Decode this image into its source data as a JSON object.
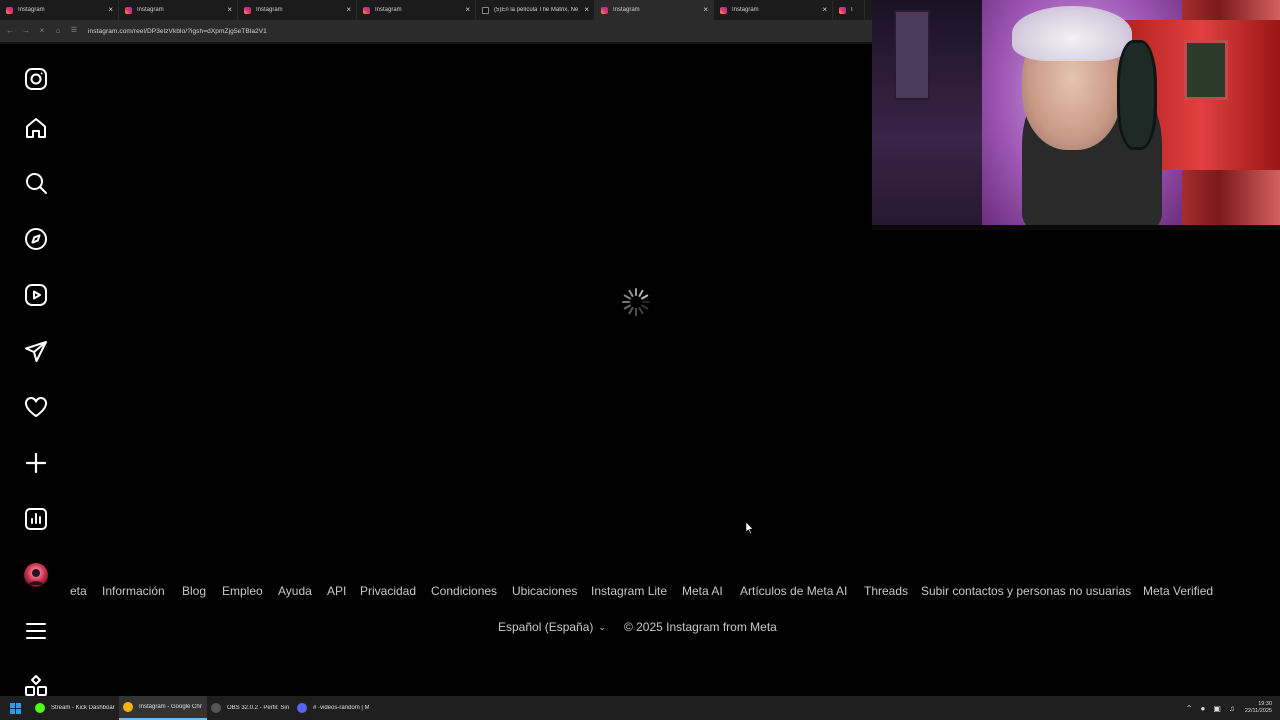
{
  "browser": {
    "tabs": [
      {
        "title": "Instagram",
        "icon": "instagram-favicon",
        "active": false
      },
      {
        "title": "Instagram",
        "icon": "instagram-favicon",
        "active": false
      },
      {
        "title": "Instagram",
        "icon": "instagram-favicon",
        "active": false
      },
      {
        "title": "Instagram",
        "icon": "instagram-favicon",
        "active": false
      },
      {
        "title": "(5)En la película The Matrix, Ne",
        "icon": "tiktok-favicon",
        "active": false
      },
      {
        "title": "Instagram",
        "icon": "instagram-favicon",
        "active": true
      },
      {
        "title": "Instagram",
        "icon": "instagram-favicon",
        "active": false
      },
      {
        "title": "I",
        "icon": "instagram-favicon",
        "active": false
      }
    ],
    "close_glyph": "×",
    "url": "instagram.com/reel/DP3elzVkblo/?igsh=dXpmZjg5eTBla2V1"
  },
  "sidebar": {
    "items": [
      {
        "name": "instagram-logo-icon"
      },
      {
        "name": "home-icon"
      },
      {
        "name": "search-icon"
      },
      {
        "name": "explore-icon"
      },
      {
        "name": "reels-icon"
      },
      {
        "name": "messages-icon"
      },
      {
        "name": "notifications-icon"
      },
      {
        "name": "create-icon"
      },
      {
        "name": "dashboard-icon"
      },
      {
        "name": "profile-avatar"
      },
      {
        "name": "more-menu-icon"
      },
      {
        "name": "also-from-meta-icon"
      }
    ]
  },
  "main": {
    "loading": true
  },
  "footer": {
    "links": [
      "eta",
      "Información",
      "Blog",
      "Empleo",
      "Ayuda",
      "API",
      "Privacidad",
      "Condiciones",
      "Ubicaciones",
      "Instagram Lite",
      "Meta AI",
      "Artículos de Meta AI",
      "Threads",
      "Subir contactos y personas no usuarias",
      "Meta Verified"
    ],
    "language": "Español (España)",
    "copyright": "© 2025 Instagram from Meta"
  },
  "taskbar": {
    "items": [
      {
        "label": "Stream - Kick Dashboar",
        "color": "#53fc18",
        "active": false
      },
      {
        "label": "Instagram - Google Chr",
        "color": "#f4b400",
        "active": true
      },
      {
        "label": "OBS 32.0.2 - Perfil: Sin T",
        "color": "#555555",
        "active": false
      },
      {
        "label": "# ·videos-random | M",
        "color": "#5865f2",
        "active": false
      }
    ],
    "clock_time": "19:30",
    "clock_date": "22/11/2025"
  },
  "colors": {
    "background": "#000000",
    "footer_text": "#c9c9c9",
    "icon": "#ffffff"
  }
}
